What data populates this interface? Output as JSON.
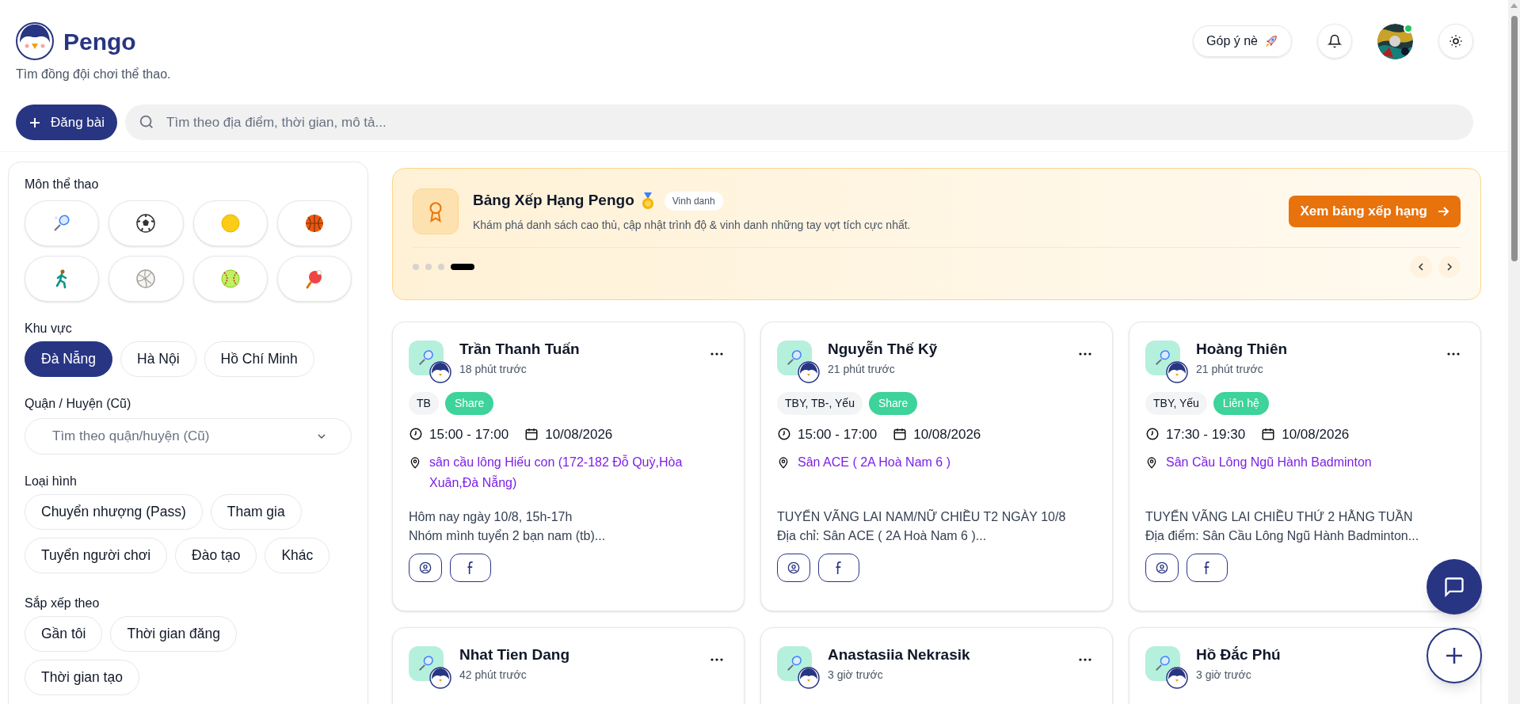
{
  "header": {
    "brand": "Pengo",
    "tagline": "Tìm đồng đội chơi thể thao.",
    "feedback_button": "Góp ý nè",
    "user": {
      "online": true
    }
  },
  "post_button": "Đăng bài",
  "search": {
    "placeholder": "Tìm theo địa điểm, thời gian, mô tả..."
  },
  "filters": {
    "sports": {
      "title": "Môn thể thao",
      "items": [
        {
          "kind": "badminton",
          "selected": false
        },
        {
          "kind": "soccer",
          "selected": false
        },
        {
          "kind": "tennis",
          "selected": false
        },
        {
          "kind": "basketball",
          "selected": false
        },
        {
          "kind": "running",
          "selected": false
        },
        {
          "kind": "volleyball",
          "selected": false
        },
        {
          "kind": "softball",
          "selected": false
        },
        {
          "kind": "pingpong",
          "selected": false
        }
      ]
    },
    "region": {
      "title": "Khu vực",
      "options": [
        {
          "label": "Đà Nẵng",
          "selected": true
        },
        {
          "label": "Hà Nội",
          "selected": false
        },
        {
          "label": "Hồ Chí Minh",
          "selected": false
        }
      ]
    },
    "district": {
      "title": "Quận / Huyện (Cũ)",
      "placeholder": "Tìm theo quận/huyện (Cũ)"
    },
    "post_type": {
      "title": "Loại hình",
      "options": [
        {
          "label": "Chuyển nhượng (Pass)",
          "selected": false
        },
        {
          "label": "Tham gia",
          "selected": false
        },
        {
          "label": "Tuyển người chơi",
          "selected": false
        },
        {
          "label": "Đào tạo",
          "selected": false
        },
        {
          "label": "Khác",
          "selected": false
        }
      ]
    },
    "sort": {
      "title": "Sắp xếp theo",
      "options": [
        {
          "label": "Gần tôi",
          "selected": false
        },
        {
          "label": "Thời gian đăng",
          "selected": false
        },
        {
          "label": "Thời gian tạo",
          "selected": false
        }
      ]
    }
  },
  "banner": {
    "title": "Bảng Xếp Hạng Pengo",
    "badge": "Vinh danh",
    "description": "Khám phá danh sách cao thủ, cập nhật trình độ & vinh danh những tay vợt tích cực nhất.",
    "button": "Xem bảng xếp hạng",
    "slides": [
      {
        "selected": false
      },
      {
        "selected": false
      },
      {
        "selected": false
      },
      {
        "selected": true
      }
    ]
  },
  "posts": [
    {
      "name": "Trần Thanh Tuấn",
      "time": "18 phút trước",
      "skill": "TB",
      "deal": "Share",
      "hours": "15:00 - 17:00",
      "date": "10/08/2026",
      "location": "sân cầu lông Hiếu con (172-182 Đỗ Quỳ,Hòa Xuân,Đà Nẵng)",
      "description": "Hôm nay ngày 10/8, 15h-17h\nNhóm mình tuyển 2 bạn nam (tb)..."
    },
    {
      "name": "Nguyễn Thế Kỹ",
      "time": "21 phút trước",
      "skill": "TBY, TB-, Yếu",
      "deal": "Share",
      "hours": "15:00 - 17:00",
      "date": "10/08/2026",
      "location": "Sân ACE ( 2A Hoà Nam 6 )",
      "description": "TUYỂN VÃNG LAI NAM/NỮ CHIỀU T2 NGÀY 10/8\nĐịa chỉ: Sân ACE ( 2A Hoà Nam 6 )..."
    },
    {
      "name": "Hoàng Thiên",
      "time": "21 phút trước",
      "skill": "TBY, Yếu",
      "deal": "Liên hệ",
      "hours": "17:30 - 19:30",
      "date": "10/08/2026",
      "location": "Sân Cầu Lông Ngũ Hành Badminton",
      "description": "TUYỂN VÃNG LAI CHIỀU THỨ 2 HẰNG TUẦN\nĐịa điểm: Sân Cầu Lông Ngũ Hành Badminton..."
    },
    {
      "name": "Nhat Tien Dang",
      "time": "42 phút trước"
    },
    {
      "name": "Anastasiia Nekrasik",
      "time": "3 giờ trước"
    },
    {
      "name": "Hồ Đắc Phú",
      "time": "3 giờ trước"
    }
  ]
}
